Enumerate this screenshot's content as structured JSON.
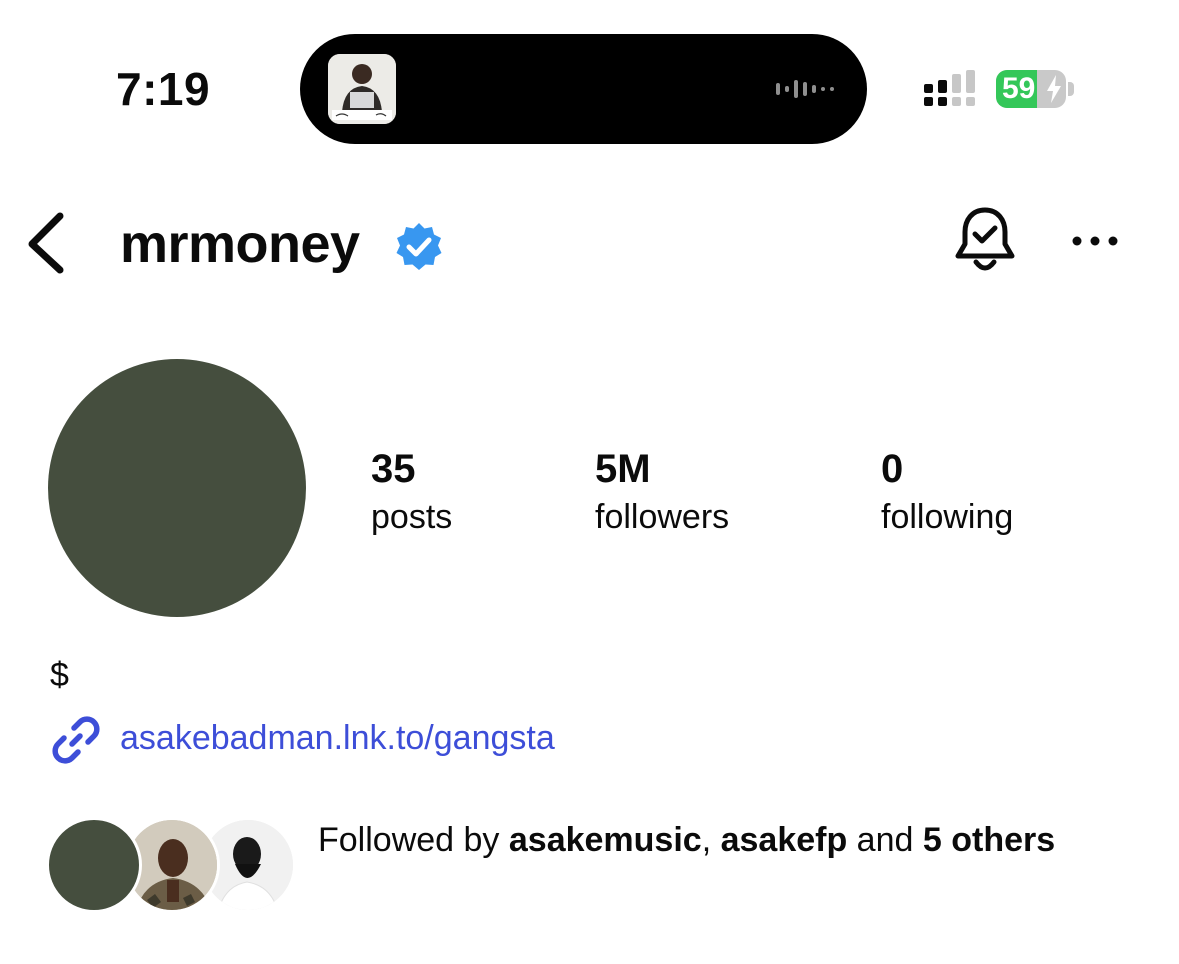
{
  "status_bar": {
    "time": "7:19",
    "battery_level": "59",
    "battery_percent": 59,
    "battery_color": "#34c759"
  },
  "header": {
    "username": "mrmoney",
    "verified_color": "#3897f0",
    "icons": [
      "back-chevron-icon",
      "verified-badge-icon",
      "notification-bell-icon",
      "more-options-icon"
    ]
  },
  "profile": {
    "avatar_color": "#454e3e",
    "stats": {
      "posts": {
        "value": "35",
        "label": "posts"
      },
      "followers": {
        "value": "5M",
        "label": "followers"
      },
      "following": {
        "value": "0",
        "label": "following"
      }
    },
    "bio": "$",
    "link": "asakebadman.lnk.to/gangsta",
    "link_color": "#3d4ed8"
  },
  "followed_by": {
    "prefix": "Followed by ",
    "user1": "asakemusic",
    "separator": ", ",
    "user2": "asakefp",
    "middle": " and ",
    "count": "5",
    "suffix": "others"
  }
}
